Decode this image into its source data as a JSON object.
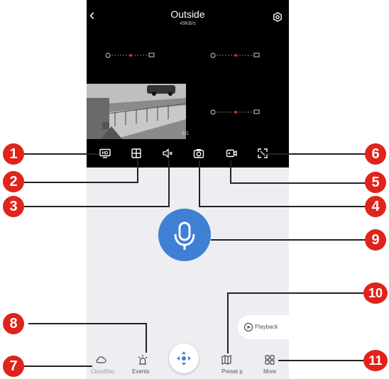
{
  "header": {
    "title": "Outside",
    "speed": "49KB/s"
  },
  "video": {
    "page_indicator": "1/1"
  },
  "nav": {
    "cloud_label": "CloudSto",
    "events_label": "Events",
    "preset_label": "Preset p",
    "more_label": "More"
  },
  "playback": {
    "label": "Playback"
  },
  "callouts": [
    "1",
    "2",
    "3",
    "4",
    "5",
    "6",
    "7",
    "8",
    "9",
    "10",
    "11"
  ],
  "colors": {
    "accent": "#3f7fd4",
    "callout": "#e0231b",
    "video_bg": "#000000",
    "panel_bg": "#eeedf1"
  }
}
